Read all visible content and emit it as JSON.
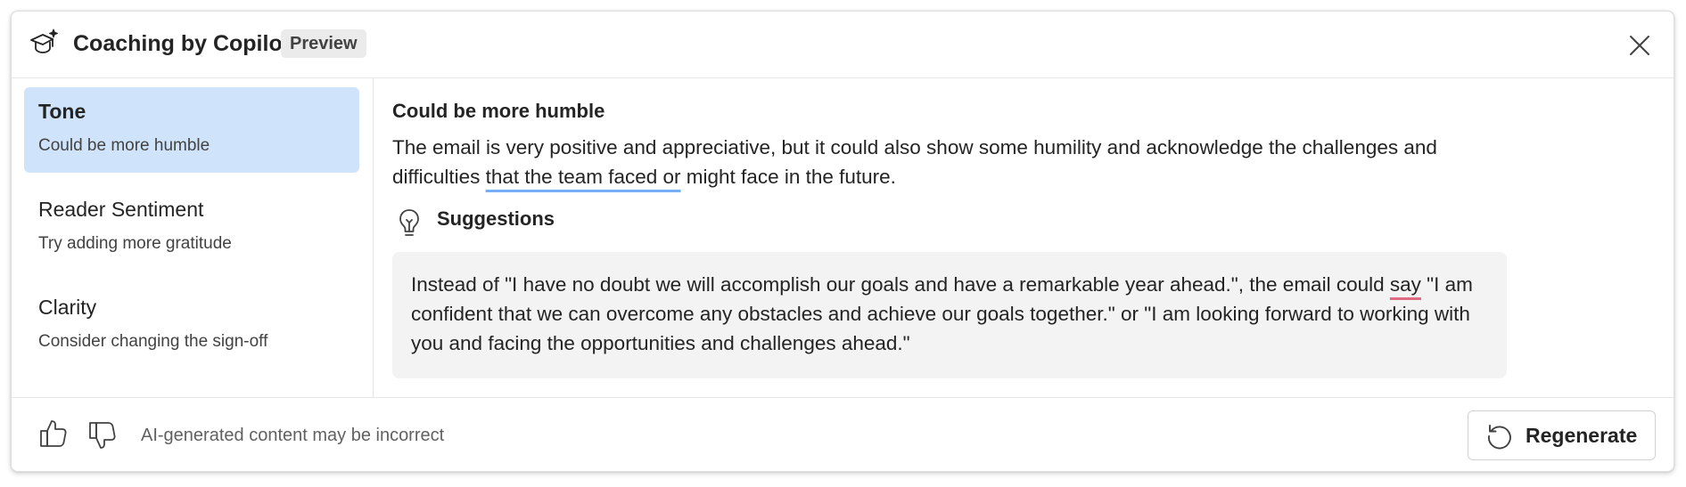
{
  "header": {
    "title": "Coaching by Copilot",
    "badge": "Preview",
    "icon": "coaching-cap-sparkle-icon",
    "close_icon": "close-icon"
  },
  "sidebar": {
    "items": [
      {
        "title": "Tone",
        "subtitle": "Could be more humble",
        "selected": true
      },
      {
        "title": "Reader Sentiment",
        "subtitle": "Try adding more gratitude",
        "selected": false
      },
      {
        "title": "Clarity",
        "subtitle": "Consider changing the sign-off",
        "selected": false
      }
    ]
  },
  "content": {
    "heading": "Could be more humble",
    "description": {
      "part1": "The email is very positive and appreciative, but it could also show some humility and acknowledge the challenges and difficulties ",
      "underlined": "that the team faced or",
      "part2": " might face in the future."
    },
    "suggestions_label": "Suggestions",
    "suggestions_icon": "lightbulb-icon",
    "suggestion": {
      "part1": "Instead of \"I have no doubt we will accomplish our goals and have a remarkable year ahead.\", the email could ",
      "underlined": "say",
      "part2": " \"I am confident that we can overcome any obstacles and achieve our goals together.\" or \"I am looking forward to working with you and facing the opportunities and challenges ahead.\""
    }
  },
  "footer": {
    "like_icon": "thumbs-up-icon",
    "dislike_icon": "thumbs-down-icon",
    "disclaimer": "AI-generated content may be incorrect",
    "regenerate_label": "Regenerate",
    "regenerate_icon": "regenerate-icon"
  },
  "colors": {
    "selected_item_bg": "#cfe4fa",
    "suggestion_bg": "#f3f3f3",
    "underline_blue": "#76aef5",
    "underline_red": "#e06c84"
  }
}
